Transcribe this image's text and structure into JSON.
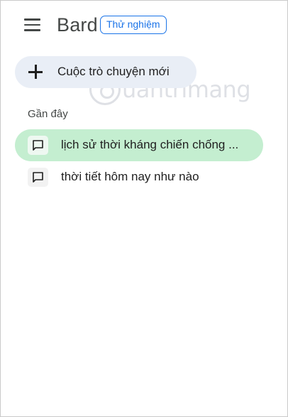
{
  "header": {
    "title": "Bard",
    "badge": "Thử nghiệm"
  },
  "new_chat": {
    "label": "Cuộc trò chuyện mới"
  },
  "recent": {
    "title": "Gần đây",
    "items": [
      {
        "label": "lịch sử thời kháng chiến chống ...",
        "active": true
      },
      {
        "label": "thời tiết hôm nay như nào",
        "active": false
      }
    ]
  },
  "watermark": {
    "text": "uantrimang"
  },
  "icons": {
    "menu": "hamburger-menu-icon",
    "new_chat": "plus-icon",
    "chat": "chat-bubble-icon"
  },
  "colors": {
    "accent": "#1a73e8",
    "active_item": "#c4eed0",
    "new_chat_bg": "#e9eef6"
  }
}
